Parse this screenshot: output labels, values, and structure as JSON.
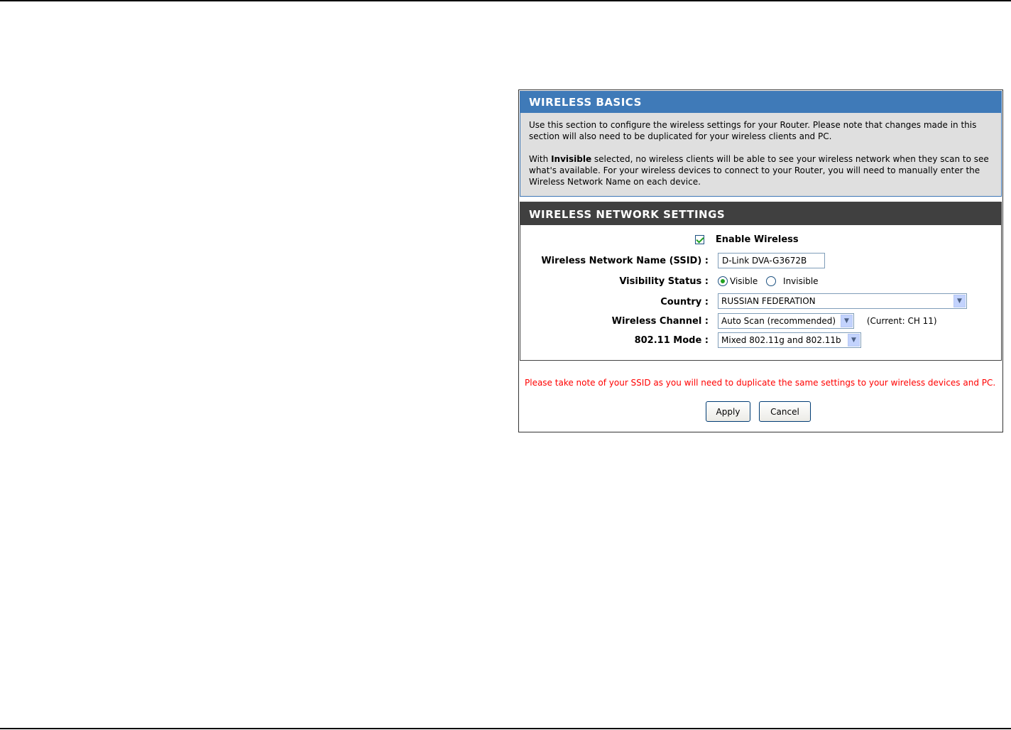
{
  "basics": {
    "title": "WIRELESS BASICS",
    "para1": "Use this section to configure the wireless settings for your Router. Please note that changes made in this section will also need to be duplicated for your wireless clients and PC.",
    "para2_prefix": "With ",
    "para2_bold": "Invisible",
    "para2_suffix": " selected, no wireless clients will be able to see your wireless network when they scan to see what's available. For your wireless devices to connect to your Router, you will need to manually enter the Wireless Network Name on each device."
  },
  "settings": {
    "title": "WIRELESS NETWORK SETTINGS",
    "enable_label": "Enable Wireless",
    "enable_checked": true,
    "ssid_label": "Wireless Network Name (SSID) :",
    "ssid_value": "D-Link DVA-G3672B",
    "visibility_label": "Visibility Status :",
    "visible_label": "Visible",
    "invisible_label": "Invisible",
    "visibility_selected": "Visible",
    "country_label": "Country :",
    "country_value": "RUSSIAN FEDERATION",
    "channel_label": "Wireless Channel :",
    "channel_value": "Auto Scan (recommended)",
    "channel_current": "(Current: CH 11)",
    "mode_label": "802.11 Mode :",
    "mode_value": "Mixed 802.11g and 802.11b"
  },
  "footer": {
    "note": "Please take note of your SSID as you will need to duplicate the same settings to your wireless devices and PC.",
    "apply_label": "Apply",
    "cancel_label": "Cancel"
  },
  "colors": {
    "basics_header": "#3f7ab8",
    "settings_header": "#404040",
    "note_text": "#ff0000"
  }
}
